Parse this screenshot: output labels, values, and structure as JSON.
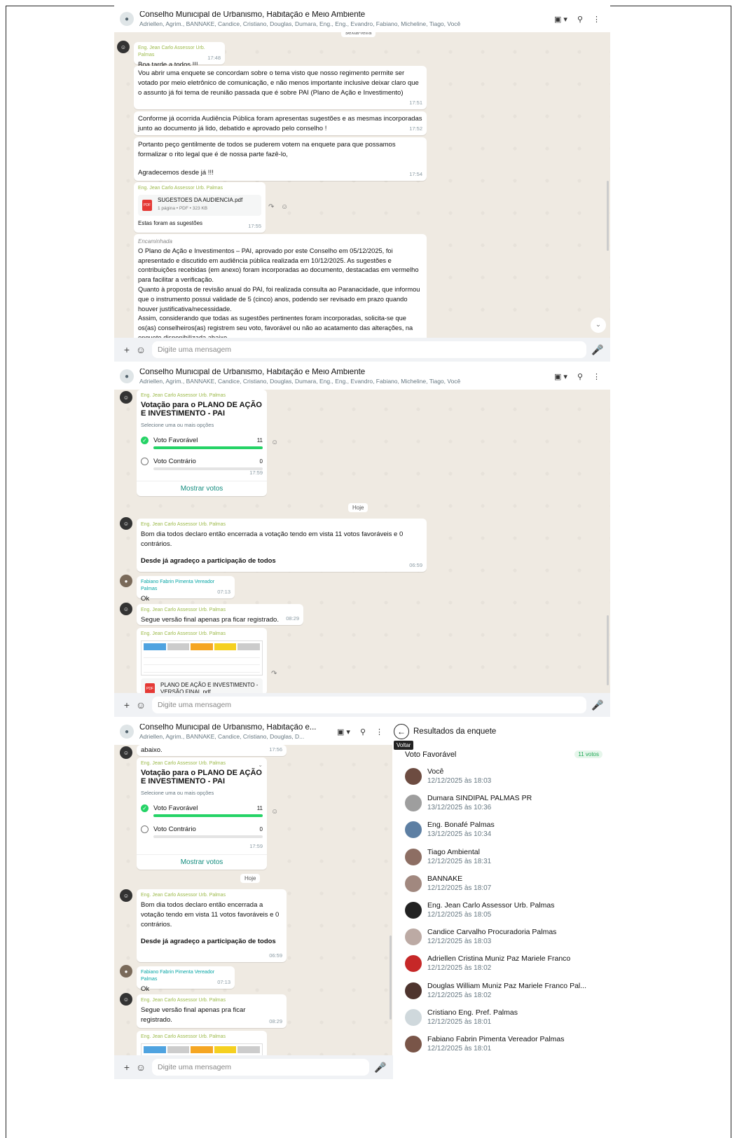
{
  "chat": {
    "title": "Conselho Municipal de Urbanismo, Habitação e Meio Ambiente",
    "title_short": "Conselho Municipal de Urbanismo, Habitação e...",
    "participants": "Adriellen, Agrim., BANNAKE, Candice, Cristiano, Douglas, Dumara, Eng., Eng., Evandro, Fabiano, Micheline, Tiago, Você",
    "participants_short": "Adriellen, Agrim., BANNAKE, Candice, Cristiano, Douglas, D..."
  },
  "composer": {
    "placeholder": "Digite uma mensagem"
  },
  "senders": {
    "jean": "Eng. Jean Carlo Assessor Urb. Palmas",
    "fabiano": "Fabiano Fabrin Pimenta Vereador Palmas"
  },
  "days": {
    "friday": "sexta-feira",
    "today": "Hoje"
  },
  "p1": {
    "m1": {
      "text": "Boa tarde a todos !!!",
      "time": "17:48"
    },
    "m2": {
      "text": "Vou abrir uma enquete se concordam sobre o tema visto que nosso regimento permite ser votado por meio eletrônico de comunicação, e não menos importante inclusive deixar claro que o assunto já foi tema de reunião passada que é sobre PAI (Plano de Ação e Investimento)",
      "time": "17:51"
    },
    "m3": {
      "text": "Conforme já ocorrida Audiência Pública foram apresentas sugestões e as mesmas incorporadas junto ao documento já lido, debatido e aprovado pelo conselho !",
      "time": "17:52"
    },
    "m4": {
      "text": "Portanto peço gentilmente de todos se puderem votem na enquete para que possamos formalizar o rito legal que é de nossa parte fazê-lo,",
      "text2": "Agradecemos desde já !!!",
      "time": "17:54"
    },
    "m5": {
      "doc": "SUGESTOES DA AUDIENCIA.pdf",
      "meta": "1 página • PDF • 323 KB",
      "caption": "Estas foram as sugestões",
      "time": "17:55"
    },
    "m6": {
      "fwd": "Encaminhada",
      "text": "O Plano de Ação e Investimentos – PAI, aprovado por este Conselho em 05/12/2025, foi apresentado e discutido em audiência pública realizada em 10/12/2025. As sugestões e contribuições recebidas (em anexo) foram incorporadas ao documento, destacadas em vermelho para facilitar a verificação.",
      "text2": "Quanto à proposta de revisão anual do PAI, foi realizada consulta ao Paranacidade, que informou que o instrumento possui validade de 5 (cinco) anos, podendo ser revisado em prazo quando houver justificativa/necessidade.",
      "text3": "Assim, considerando que todas as sugestões pertinentes foram incorporadas, solicita-se que os(as) conselheiros(as) registrem seu voto, favorável ou não ao acatamento das alterações, na enquete disponibilizada abaixo."
    }
  },
  "poll": {
    "title": "Votação para o PLANO DE AÇÃO E INVESTIMENTO - PAI",
    "hint": "Selecione uma ou mais opções",
    "opt1": "Voto Favorável",
    "opt1_count": "11",
    "opt1_fraction": 1.0,
    "opt2": "Voto Contrário",
    "opt2_count": "0",
    "opt2_fraction": 0.0,
    "time": "17:59",
    "show": "Mostrar votos"
  },
  "msgs": {
    "close": "Bom dia todos declaro então encerrada a votação tendo em vista 11 votos favoráveis e 0 contrários.",
    "thanks": "Desde já agradeço a participação de todos",
    "close_time": "06:59",
    "ok": "Ok",
    "ok_time": "07:13",
    "final": "Segue versão final apenas pra ficar registrado.",
    "final_time": "08:29",
    "final_doc": "PLANO DE AÇÃO E INVESTIMENTO - VERSÃO FINAL.pdf",
    "abaixo": "abaixo.",
    "abaixo_time": "17:56"
  },
  "results": {
    "title": "Resultados da enquete",
    "tooltip": "Voltar",
    "option": "Voto Favorável",
    "votes": "11 votos",
    "voters": [
      {
        "name": "Você",
        "time": "12/12/2025 às 18:03"
      },
      {
        "name": "Dumara SINDIPAL PALMAS PR",
        "time": "13/12/2025 às 10:36"
      },
      {
        "name": "Eng. Bonafé Palmas",
        "time": "13/12/2025 às 10:34"
      },
      {
        "name": "Tiago Ambiental",
        "time": "12/12/2025 às 18:31"
      },
      {
        "name": "BANNAKE",
        "time": "12/12/2025 às 18:07"
      },
      {
        "name": "Eng. Jean Carlo Assessor Urb. Palmas",
        "time": "12/12/2025 às 18:05"
      },
      {
        "name": "Candice Carvalho Procuradoria Palmas",
        "time": "12/12/2025 às 18:03"
      },
      {
        "name": "Adriellen Cristina Muniz Paz Mariele Franco",
        "time": "12/12/2025 às 18:02"
      },
      {
        "name": "Douglas William Muniz Paz Mariele Franco Pal...",
        "time": "12/12/2025 às 18:02"
      },
      {
        "name": "Cristiano Eng. Pref. Palmas",
        "time": "12/12/2025 às 18:01"
      },
      {
        "name": "Fabiano Fabrin Pimenta Vereador Palmas",
        "time": "12/12/2025 às 18:01"
      }
    ]
  },
  "colors": {
    "accent": "#25d366",
    "bg": "#efeae2",
    "link": "#128c7e"
  }
}
